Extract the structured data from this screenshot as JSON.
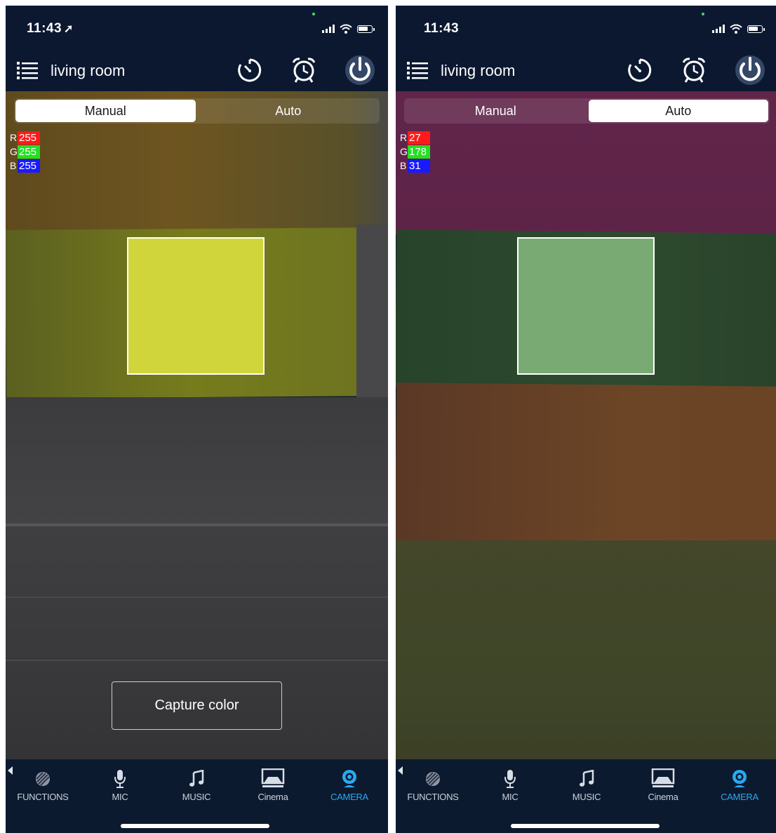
{
  "left": {
    "status": {
      "time": "11:43",
      "location_arrow": "location-arrow-icon"
    },
    "header": {
      "title": "living room"
    },
    "mode_tabs": [
      {
        "label": "Manual",
        "active": true
      },
      {
        "label": "Auto",
        "active": false
      }
    ],
    "rgb": {
      "r_label": "R",
      "r": "255",
      "g_label": "G",
      "g": "255",
      "b_label": "B",
      "b": "255"
    },
    "target_color": "#cfd53a",
    "capture_label": "Capture color",
    "tabs": [
      "FUNCTIONS",
      "MIC",
      "MUSIC",
      "Cinema",
      "CAMERA"
    ],
    "active_tab": "CAMERA"
  },
  "right": {
    "status": {
      "time": "11:43"
    },
    "header": {
      "title": "living room"
    },
    "mode_tabs": [
      {
        "label": "Manual",
        "active": false
      },
      {
        "label": "Auto",
        "active": true
      }
    ],
    "rgb": {
      "r_label": "R",
      "r": "27",
      "g_label": "G",
      "g": "178",
      "b_label": "B",
      "b": "31"
    },
    "target_color": "#7aaa74",
    "tabs": [
      "FUNCTIONS",
      "MIC",
      "MUSIC",
      "Cinema",
      "CAMERA"
    ],
    "active_tab": "CAMERA"
  },
  "colors": {
    "rgb_red": "#ff1a1a",
    "rgb_green": "#22e022",
    "rgb_blue": "#1a1aff",
    "accent": "#2aa9f0",
    "bar_bg": "#0b1830"
  }
}
